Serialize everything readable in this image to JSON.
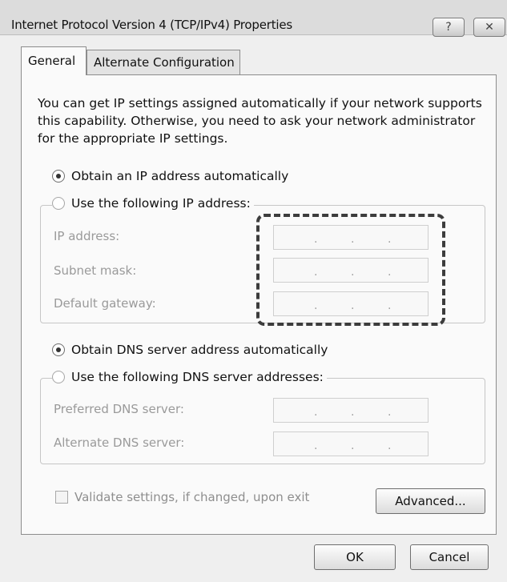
{
  "window": {
    "title": "Internet Protocol Version 4 (TCP/IPv4) Properties",
    "help_glyph": "?",
    "close_glyph": "✕"
  },
  "tabs": [
    {
      "label": "General",
      "selected": true
    },
    {
      "label": "Alternate Configuration",
      "selected": false
    }
  ],
  "intro_text": "You can get IP settings assigned automatically if your network supports this capability. Otherwise, you need to ask your network administrator for the appropriate IP settings.",
  "ip": {
    "auto_label": "Obtain an IP address automatically",
    "auto_selected": true,
    "manual_label": "Use the following IP address:",
    "fields": [
      {
        "label": "IP address:",
        "value": ""
      },
      {
        "label": "Subnet mask:",
        "value": ""
      },
      {
        "label": "Default gateway:",
        "value": ""
      }
    ]
  },
  "dns": {
    "auto_label": "Obtain DNS server address automatically",
    "auto_selected": true,
    "manual_label": "Use the following DNS server addresses:",
    "fields": [
      {
        "label": "Preferred DNS server:",
        "value": ""
      },
      {
        "label": "Alternate DNS server:",
        "value": ""
      }
    ]
  },
  "validate": {
    "label": "Validate settings, if changed, upon exit",
    "checked": false
  },
  "buttons": {
    "advanced": "Advanced...",
    "ok": "OK",
    "cancel": "Cancel"
  },
  "colors": {
    "highlight_border": "#3c3c3c"
  }
}
